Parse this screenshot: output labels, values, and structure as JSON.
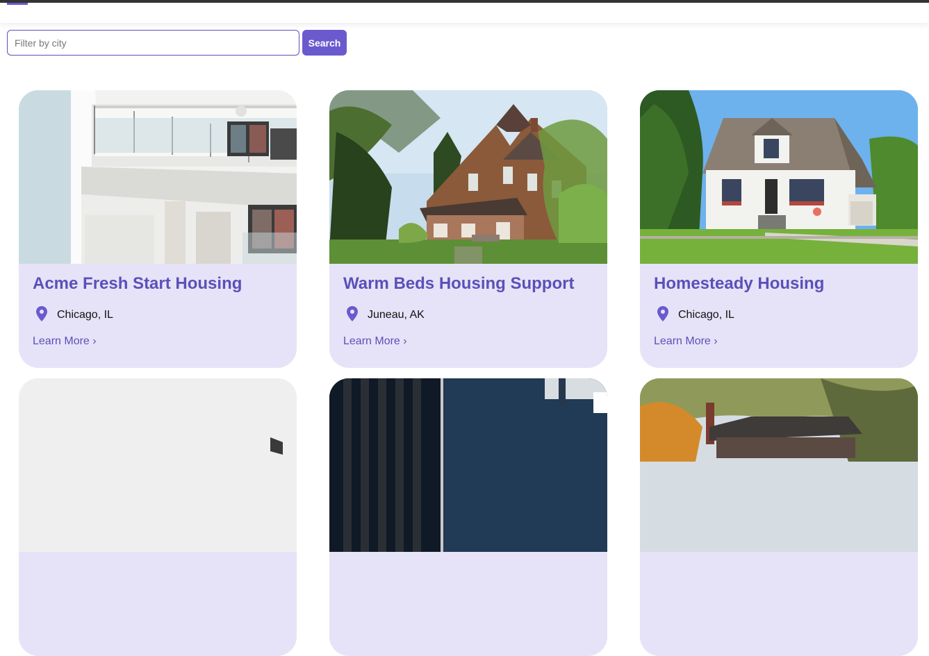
{
  "search": {
    "placeholder": "Filter by city",
    "value": "",
    "button_label": "Search"
  },
  "listings": [
    {
      "title": "Acme Fresh Start Housing",
      "location": "Chicago, IL",
      "link_label": "Learn More ›",
      "image": "white-modern-apartment-balconies"
    },
    {
      "title": "Warm Beds Housing Support",
      "location": "Juneau, AK",
      "link_label": "Learn More ›",
      "image": "victorian-brick-house-trees"
    },
    {
      "title": "Homesteady Housing",
      "location": "Chicago, IL",
      "link_label": "Learn More ›",
      "image": "white-cape-cod-house-lawn"
    },
    {
      "title": "",
      "location": "",
      "link_label": "",
      "image": "white-minimal-wall"
    },
    {
      "title": "",
      "location": "",
      "link_label": "",
      "image": "dark-blue-modern-building"
    },
    {
      "title": "",
      "location": "",
      "link_label": "",
      "image": "house-autumn-trees"
    }
  ],
  "colors": {
    "accent": "#6a5acd",
    "card_background": "#e6e3f8",
    "title_color": "#5b50b8"
  },
  "icons": {
    "location": "map-pin-icon"
  }
}
